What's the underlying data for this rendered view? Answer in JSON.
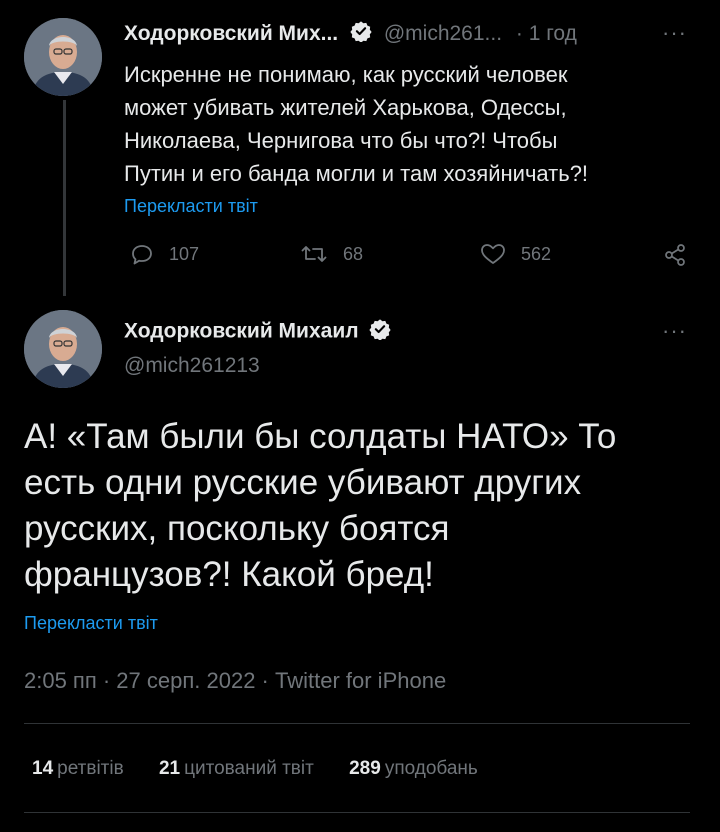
{
  "tweet1": {
    "author_name": "Ходорковский Мих...",
    "handle": "@mich261...",
    "time": "· 1 год",
    "more": "···",
    "text_lines": [
      "Искренне не понимаю, как русский человек",
      "может убивать жителей Харькова, Одессы,",
      "Николаева, Чернигова что бы что?! Чтобы",
      "Путин и его банда могли и там хозяйничать?!"
    ],
    "translate": "Перекласти твіт",
    "replies": "107",
    "retweets": "68",
    "likes": "562"
  },
  "tweet2": {
    "author_name": "Ходорковский Михаил",
    "handle": "@mich261213",
    "more": "···",
    "text_lines": [
      "А! «Там были бы солдаты НАТО» То",
      "есть одни русские убивают других",
      "русских, поскольку боятся",
      "французов?! Какой бред!"
    ],
    "translate": "Перекласти твіт",
    "meta": "2:05 пп · 27 серп. 2022 · Twitter for iPhone",
    "stats": {
      "retweets_count": "14",
      "retweets_label": "ретвітів",
      "quotes_count": "21",
      "quotes_label": "цитований твіт",
      "likes_count": "289",
      "likes_label": "уподобань"
    }
  },
  "colors": {
    "background": "#000000",
    "text": "#e7e9ea",
    "muted": "#71767b",
    "link": "#1d9bf0",
    "divider": "#2f3336"
  }
}
